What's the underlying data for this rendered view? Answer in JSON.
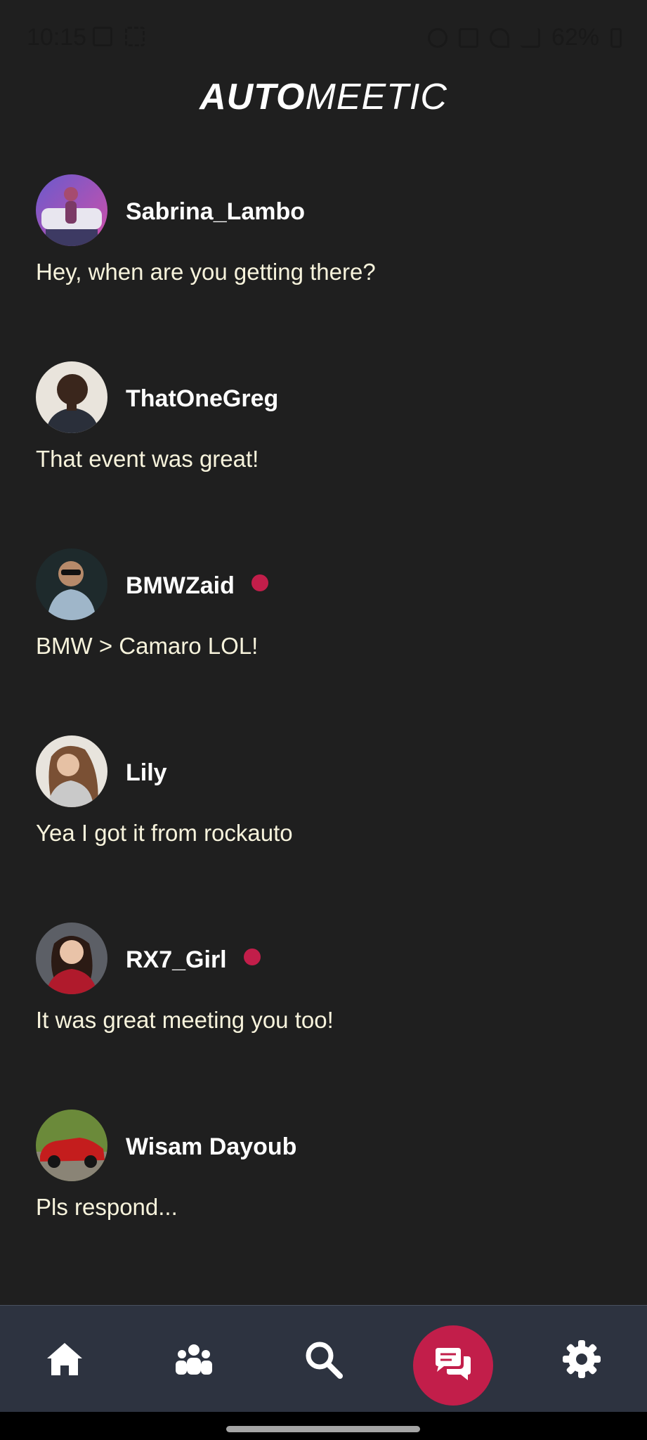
{
  "status_bar": {
    "time": "10:15",
    "battery": "62%"
  },
  "app": {
    "title_bold": "AUTO",
    "title_light": "MEETIC"
  },
  "chats": [
    {
      "username": "Sabrina_Lambo",
      "message": "Hey, when are you getting there?",
      "unread": false,
      "avatar": "woman-with-white-car"
    },
    {
      "username": "ThatOneGreg",
      "message": "That event was great!",
      "unread": false,
      "avatar": "smiling-man"
    },
    {
      "username": "BMWZaid",
      "message": "BMW > Camaro LOL!",
      "unread": true,
      "avatar": "man-with-sunglasses"
    },
    {
      "username": "Lily",
      "message": "Yea I got it from rockauto",
      "unread": false,
      "avatar": "woman-long-hair"
    },
    {
      "username": "RX7_Girl",
      "message": "It was great meeting you too!",
      "unread": true,
      "avatar": "woman-red-top"
    },
    {
      "username": "Wisam Dayoub",
      "message": "Pls respond...",
      "unread": false,
      "avatar": "red-classic-car"
    }
  ],
  "nav": {
    "items": [
      {
        "icon": "home-icon"
      },
      {
        "icon": "users-icon"
      },
      {
        "icon": "search-icon"
      },
      {
        "icon": "messages-icon",
        "active": true
      },
      {
        "icon": "settings-icon"
      }
    ]
  },
  "colors": {
    "background": "#1f1f1f",
    "accent": "#c21e4a",
    "nav_background": "#2d3340",
    "message_text": "#f7f3dc"
  }
}
